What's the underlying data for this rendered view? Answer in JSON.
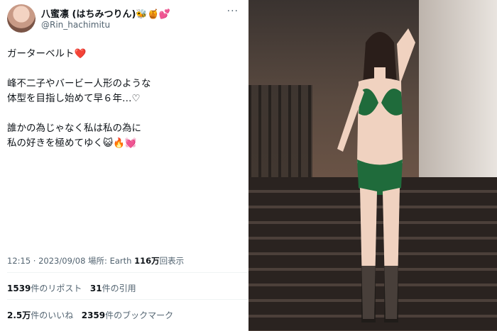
{
  "tweet": {
    "display_name": "八蜜凛 (はちみつりん)🐝🍯💕",
    "handle": "@Rin_hachimitu",
    "more_icon": "more-icon",
    "lines": [
      "ガーターベルト❤️",
      "峰不二子やバービー人形のような",
      "体型を目指し始めて早６年…♡",
      "誰かの為じゃなく私は私の為に",
      "私の好きを極めてゆく😺🔥💓"
    ],
    "time": "12:15 · 2023/09/08",
    "place_label": "場所: Earth",
    "views_count": "116万",
    "views_label": "回表示",
    "retweets_count": "1539",
    "retweets_label": "件のリポスト",
    "quotes_count": "31",
    "quotes_label": "件の引用",
    "likes_count": "2.5万",
    "likes_label": "件のいいね",
    "bookmarks_count": "2359",
    "bookmarks_label": "件のブックマーク"
  },
  "photo": {
    "subject": "woman in green lace lingerie on staircase"
  },
  "colors": {
    "text": "#0f1419",
    "secondary": "#536471",
    "divider": "#eff3f4",
    "lace": "#1f6b3b"
  }
}
